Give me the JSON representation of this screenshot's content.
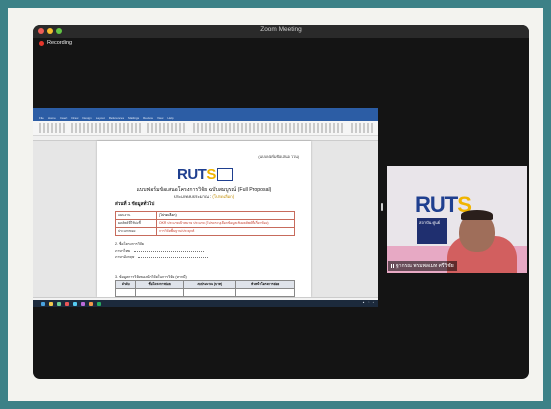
{
  "window": {
    "title": "Zoom Meeting",
    "recording_label": "Recording",
    "traffic_light_colors": [
      "#ee5e57",
      "#f5bd2f",
      "#62c545"
    ]
  },
  "shared_screen": {
    "word": {
      "tabs": [
        "File",
        "Home",
        "Insert",
        "Draw",
        "Design",
        "Layout",
        "References",
        "Mailings",
        "Review",
        "View",
        "Help"
      ]
    },
    "document": {
      "header_tag": "(แบบฟอร์มข้อเสนอ ววน)",
      "logo_text_1": "RUT",
      "logo_text_2": "S",
      "title": "แบบฟอร์มข้อเสนอโครงการวิจัย ฉบับสมบูรณ์ (Full Proposal)",
      "subtitle_prefix": "ประเภทงบประมาณ :",
      "subtitle_value": "(โปรดเลือก)",
      "section1": "ส่วนที่ 1 ข้อมูลทั่วไป",
      "info_table": [
        {
          "key": "แผนงาน",
          "value": "(โปรดเลือก)",
          "red": false
        },
        {
          "key": "ผลลัพธ์ที่ใช้บ่งชี้",
          "value": "OKR ประเภทเป้าหมาย ประเภท (โปรดระบุเลือกข้อมูลเชิงผลลัพธ์ที่เกี่ยวข้อง)",
          "red": true
        },
        {
          "key": "ประเภทของ",
          "value": "การวิจัยพื้นฐาน/ประยุกต์",
          "red": true
        }
      ],
      "section2_items": [
        "2. ชื่อโครงการวิจัย",
        "ภาษาไทย",
        "ภาษาอังกฤษ"
      ],
      "section3": "3. ข้อมูลการวิจัยของนักวิจัยในการวิจัย (หากมี)",
      "project_table_headers": [
        "ลำดับ",
        "ชื่อโครงการย่อย",
        "งบประมาณ (บาท)",
        "หัวหน้าโครงการย่อย"
      ]
    },
    "taskbar_colors": [
      "#4aa3df",
      "#f2c94c",
      "#6fcf97",
      "#eb5757",
      "#56ccf2",
      "#bb6bd9",
      "#f2994a",
      "#27ae60"
    ]
  },
  "participant": {
    "name": "ฐากรณ พรมพลเมท ศรีวิชัย",
    "logo_main": "RUT",
    "logo_accent": "S",
    "sign_text": "สถาบัน ศูนย์"
  }
}
